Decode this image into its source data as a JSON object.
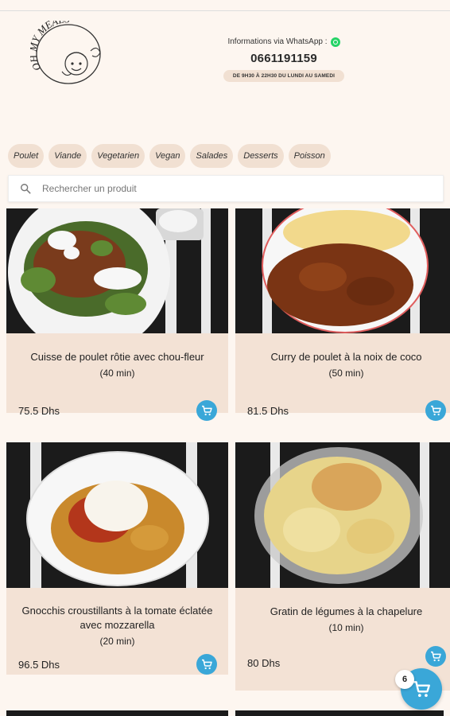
{
  "brand": {
    "logo_text": "OH MY MEALS"
  },
  "contact": {
    "label": "Informations via WhatsApp :",
    "phone": "0661191159",
    "hours": "DE 9H30 À 22H30 DU LUNDI AU SAMEDI"
  },
  "categories": [
    "Poulet",
    "Viande",
    "Vegetarien",
    "Vegan",
    "Salades",
    "Desserts",
    "Poisson"
  ],
  "search": {
    "placeholder": "Rechercher un produit"
  },
  "products": [
    {
      "title": "Cuisse de poulet rôtie avec chou-fleur",
      "duration": "(40 min)",
      "price": "75.5 Dhs"
    },
    {
      "title": "Curry de poulet à la noix de coco",
      "duration": "(50 min)",
      "price": "81.5 Dhs"
    },
    {
      "title": "Gnocchis croustillants à la tomate éclatée avec mozzarella",
      "duration": "(20 min)",
      "price": "96.5 Dhs"
    },
    {
      "title": "Gratin de légumes à la chapelure",
      "duration": "(10 min)",
      "price": "80 Dhs"
    }
  ],
  "cart": {
    "count": "6"
  },
  "colors": {
    "accent": "#3aa7d8",
    "card_bg": "#f3e2d5",
    "page_bg": "#fdf6f0",
    "whatsapp": "#25d366"
  }
}
